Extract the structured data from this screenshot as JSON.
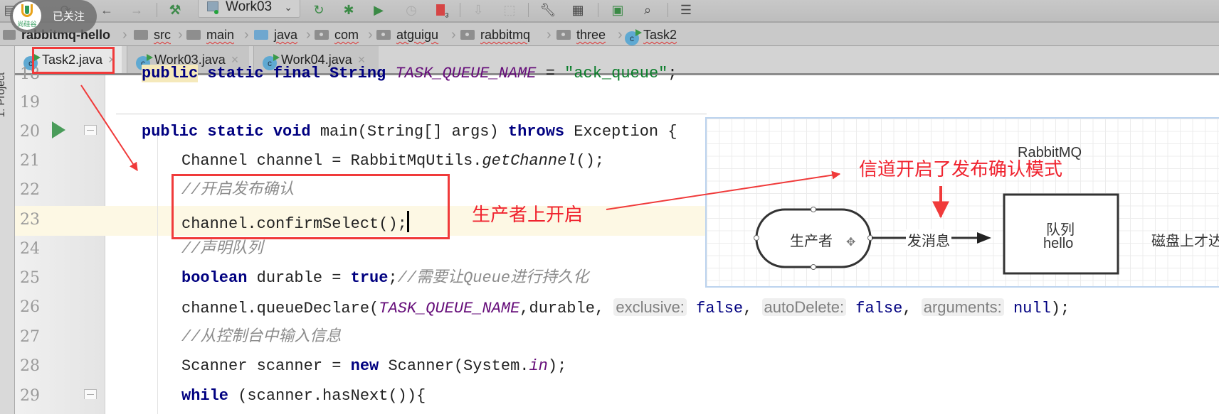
{
  "toolbar": {
    "run_config": "Work03",
    "icons": [
      "save-icon",
      "sync-icon",
      "back-icon",
      "forward-icon",
      "build-hammer-icon",
      "rerun-icon",
      "debug-icon",
      "run-coverage-icon",
      "profile-icon",
      "stop-icon",
      "update-icon",
      "deploy-icon",
      "settings-wrench-icon",
      "project-structure-icon",
      "run-window-icon",
      "search-icon",
      "frames-icon"
    ],
    "stop_badge": "3"
  },
  "overlay_badge": {
    "logo_text": "尚硅谷",
    "label": "已关注"
  },
  "breadcrumb": [
    {
      "label": "rabbitmq-hello",
      "icon": "module-icon"
    },
    {
      "label": "src",
      "icon": "folder-icon"
    },
    {
      "label": "main",
      "icon": "folder-icon"
    },
    {
      "label": "java",
      "icon": "source-folder-icon"
    },
    {
      "label": "com",
      "icon": "package-icon"
    },
    {
      "label": "atguigu",
      "icon": "package-icon"
    },
    {
      "label": "rabbitmq",
      "icon": "package-icon"
    },
    {
      "label": "three",
      "icon": "package-icon"
    },
    {
      "label": "Task2",
      "icon": "class-icon"
    }
  ],
  "side_panel": {
    "label": "1: Project"
  },
  "tabs": [
    {
      "label": "Task2.java",
      "active": true
    },
    {
      "label": "Work03.java",
      "active": false
    },
    {
      "label": "Work04.java",
      "active": false
    }
  ],
  "editor": {
    "line_numbers": [
      "18",
      "19",
      "20",
      "21",
      "22",
      "23",
      "24",
      "25",
      "26",
      "27",
      "28",
      "29"
    ],
    "current_line": "23",
    "lines": {
      "l18": {
        "a": "public",
        "b": " static final String ",
        "c": "TASK_QUEUE_NAME",
        "d": " = ",
        "e": "\"ack_queue\"",
        "f": ";"
      },
      "l20": {
        "a": "public static void ",
        "b": "main(String[] args) ",
        "c": "throws",
        "d": " Exception {"
      },
      "l21": {
        "a": "Channel channel = RabbitMqUtils.",
        "b": "getChannel",
        "c": "();"
      },
      "l22": {
        "a": "//开启发布确认"
      },
      "l23": {
        "a": "channel.confirmSelect();"
      },
      "l24": {
        "a": "//声明队列"
      },
      "l25": {
        "a": "boolean",
        "b": " durable = ",
        "c": "true",
        "d": ";",
        "e": "//需要让Queue进行持久化"
      },
      "l26": {
        "a": "channel.queueDeclare(",
        "b": "TASK_QUEUE_NAME",
        "c": ",durable, ",
        "h1": "exclusive:",
        "v1": "false",
        "s1": ", ",
        "h2": "autoDelete:",
        "v2": "false",
        "s2": ", ",
        "h3": "arguments:",
        "v3": "null",
        "end": ");"
      },
      "l27": {
        "a": "//从控制台中输入信息"
      },
      "l28": {
        "a": "Scanner scanner = ",
        "b": "new",
        "c": " Scanner(System.",
        "d": "in",
        "e": ");"
      },
      "l29": {
        "a": "while",
        "b": " (scanner.hasNext()){"
      }
    }
  },
  "annotations": {
    "producer_note": "生产者上开启",
    "channel_note": "信道开启了发布确认模式"
  },
  "diagram": {
    "title": "RabbitMQ",
    "producer": "生产者",
    "edge_label": "发消息",
    "queue_line1": "队列",
    "queue_line2": "hello",
    "disk_text": "磁盘上才达"
  },
  "colors": {
    "annotation_red": "#f03a3a",
    "keyword": "#000080",
    "comment": "#8c8c8c",
    "constant": "#660e7a",
    "string": "#0a7d2a",
    "current_line": "#fdf8e4"
  }
}
